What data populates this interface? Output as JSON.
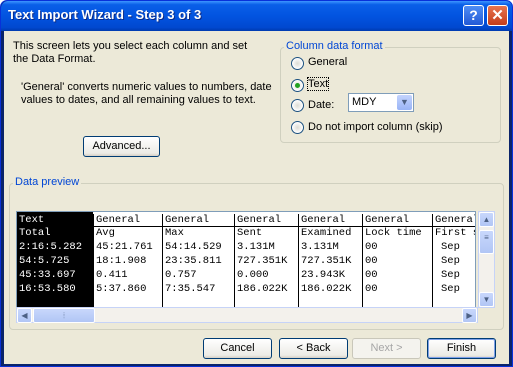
{
  "window": {
    "title": "Text Import Wizard - Step 3 of 3",
    "help_glyph": "?",
    "close_glyph": "✕"
  },
  "intro": {
    "line1": "This screen lets you select each column and set",
    "line2": "the Data Format.",
    "general_line1": "'General' converts numeric values to numbers, date",
    "general_line2": "values to dates, and all remaining values to text."
  },
  "advanced_button": "Advanced...",
  "column_format": {
    "legend": "Column data format",
    "options": [
      {
        "label": "General",
        "selected": false
      },
      {
        "label": "Text",
        "selected": true
      },
      {
        "label": "Date:",
        "selected": false
      },
      {
        "label": "Do not import column (skip)",
        "selected": false
      }
    ],
    "date_format": "MDY"
  },
  "preview": {
    "legend": "Data preview",
    "headers": [
      "Text",
      "General",
      "General",
      "General",
      "General",
      "General",
      "General"
    ],
    "columns": [
      [
        "Total",
        "2:16:5.282",
        "54:5.725",
        "45:33.697",
        "16:53.580"
      ],
      [
        "Avg",
        "45:21.761",
        "18:1.908",
        "0.411",
        "5:37.860"
      ],
      [
        "Max",
        "54:14.529",
        "23:35.811",
        "0.757",
        "7:35.547"
      ],
      [
        "Sent",
        "3.131M",
        "727.351K",
        "0.000",
        "186.022K"
      ],
      [
        "Examined",
        "3.131M",
        "727.351K",
        "23.943K",
        "186.022K"
      ],
      [
        "Lock time",
        "00",
        "00",
        "00",
        "00"
      ],
      [
        "First s",
        "Sep",
        "Sep",
        "Sep",
        "Sep"
      ]
    ]
  },
  "buttons": {
    "cancel": "Cancel",
    "back": "< Back",
    "next": "Next >",
    "finish": "Finish"
  }
}
